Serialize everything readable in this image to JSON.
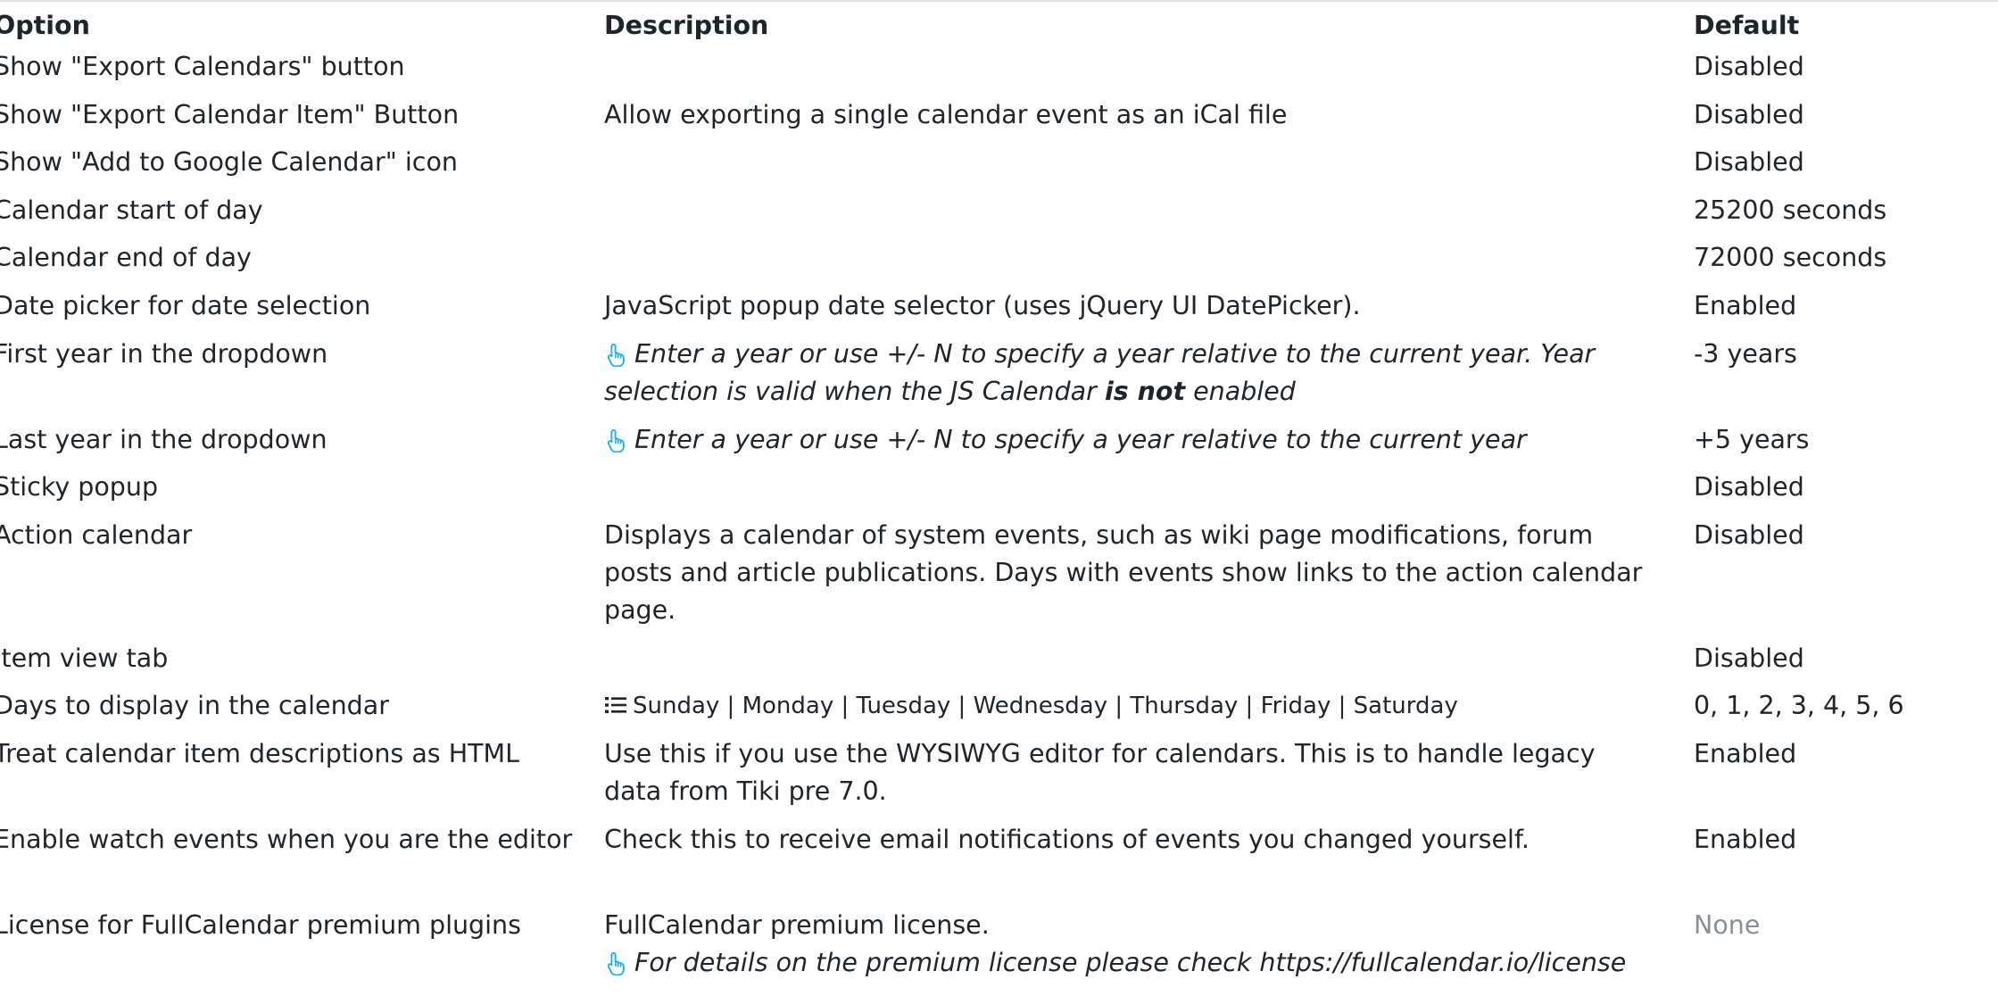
{
  "header": {
    "option": "Option",
    "description": "Description",
    "default": "Default"
  },
  "rows": [
    {
      "option": "Show \"Export Calendars\" button",
      "description": "",
      "default": "Disabled"
    },
    {
      "option": "Show \"Export Calendar Item\" Button",
      "description": "Allow exporting a single calendar event as an iCal file",
      "default": "Disabled"
    },
    {
      "option": "Show \"Add to Google Calendar\" icon",
      "description": "",
      "default": "Disabled"
    },
    {
      "option": "Calendar start of day",
      "description": "",
      "default": "25200 seconds"
    },
    {
      "option": "Calendar end of day",
      "description": "",
      "default": "72000 seconds"
    },
    {
      "option": "Date picker for date selection",
      "description": "JavaScript popup date selector (uses jQuery UI DatePicker).",
      "default": "Enabled"
    },
    {
      "option": "First year in the dropdown",
      "hint_part1": "Enter a year or use +/- N to specify a year relative to the current year. Year selection is valid when the JS Calendar ",
      "hint_bold": "is not",
      "hint_part2": " enabled",
      "default": "-3 years"
    },
    {
      "option": "Last year in the dropdown",
      "hint": "Enter a year or use +/- N to specify a year relative to the current year",
      "default": "+5 years"
    },
    {
      "option": "Sticky popup",
      "description": "",
      "default": "Disabled"
    },
    {
      "option": "Action calendar",
      "description": "Displays a calendar of system events, such as wiki page modifications, forum posts and article publications. Days with events show links to the action calendar page.",
      "default": "Disabled"
    },
    {
      "option": "Item view tab",
      "description": "",
      "default": "Disabled"
    },
    {
      "option": "Days to display in the calendar",
      "description": "Sunday | Monday | Tuesday | Wednesday | Thursday | Friday | Saturday",
      "default": "0, 1, 2, 3, 4, 5, 6"
    },
    {
      "option": "Treat calendar item descriptions as HTML",
      "description": "Use this if you use the WYSIWYG editor for calendars. This is to handle legacy data from Tiki pre 7.0.",
      "default": "Enabled"
    },
    {
      "option": "Enable watch events when you are the editor",
      "description": "Check this to receive email notifications of events you changed yourself.",
      "default": "Enabled"
    },
    {
      "option": "License for FullCalendar premium plugins",
      "description": "FullCalendar premium license.",
      "hint": "For details on the premium license please check https://fullcalendar.io/license",
      "default": "None"
    }
  ],
  "colors": {
    "text": "#212529",
    "icon": "#1ab2e8",
    "muted": "#8a8f94",
    "border": "#dee2e6"
  },
  "icons": {
    "hint": "hand-pointer-icon",
    "list": "list-icon"
  }
}
